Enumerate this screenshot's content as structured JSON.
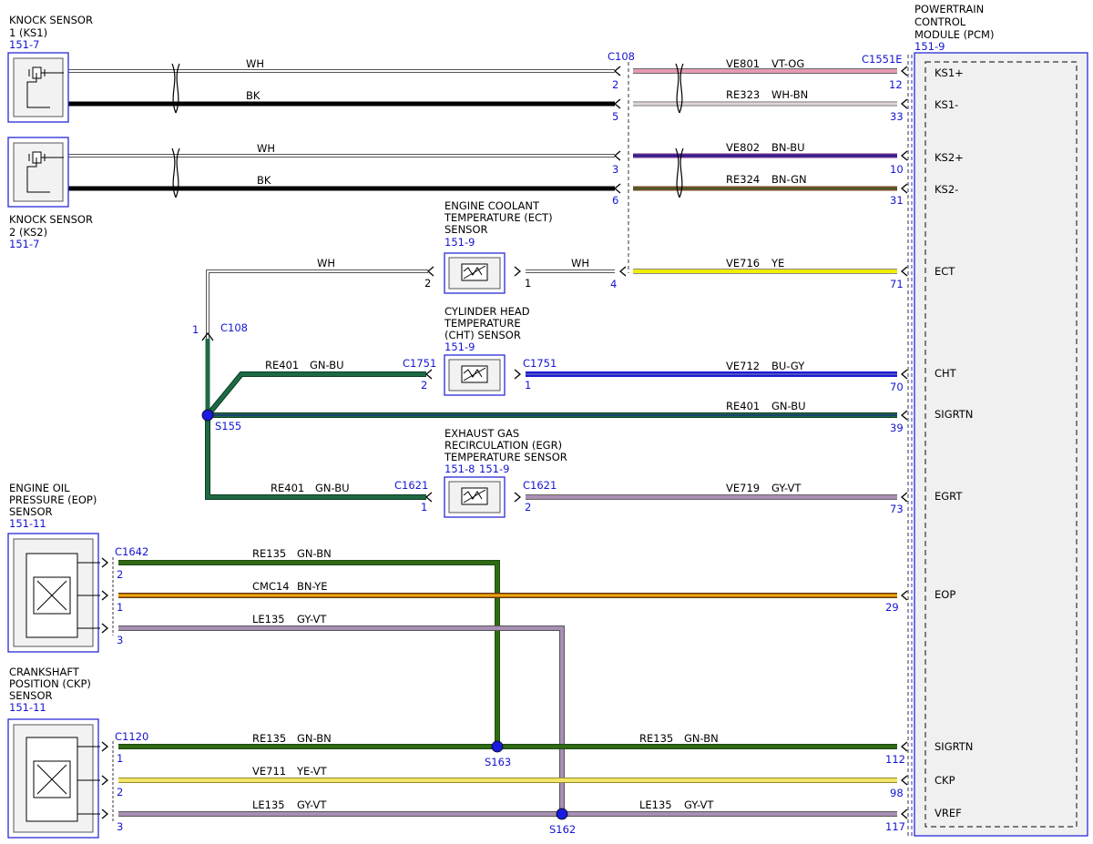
{
  "components": {
    "ks1": {
      "lines": [
        "KNOCK SENSOR",
        "1 (KS1)"
      ],
      "ref": "151-7"
    },
    "ks2": {
      "lines": [
        "KNOCK SENSOR",
        "2 (KS2)"
      ],
      "ref": "151-7"
    },
    "pcm": {
      "lines": [
        "POWERTRAIN",
        "CONTROL",
        "MODULE (PCM)"
      ],
      "ref": "151-9"
    },
    "ect": {
      "lines": [
        "ENGINE COOLANT",
        "TEMPERATURE (ECT)",
        "SENSOR"
      ],
      "ref": "151-9"
    },
    "cht": {
      "lines": [
        "CYLINDER HEAD",
        "TEMPERATURE",
        "(CHT) SENSOR"
      ],
      "ref": "151-9"
    },
    "egr": {
      "lines": [
        "EXHAUST GAS",
        "RECIRCULATION (EGR)",
        "TEMPERATURE SENSOR"
      ],
      "ref": "151-8",
      "ref2": "151-9"
    },
    "eop": {
      "lines": [
        "ENGINE OIL",
        "PRESSURE (EOP)",
        "SENSOR"
      ],
      "ref": "151-11"
    },
    "ckp": {
      "lines": [
        "CRANKSHAFT",
        "POSITION (CKP)",
        "SENSOR"
      ],
      "ref": "151-11"
    }
  },
  "pcm_pins": [
    "KS1+",
    "KS1-",
    "KS2+",
    "KS2-",
    "ECT",
    "CHT",
    "SIGRTN",
    "EGRT",
    "EOP",
    "SIGRTN",
    "CKP",
    "VREF"
  ],
  "connectors": {
    "c108_top": "C108",
    "c1551e": "C1551E",
    "c108_mid": "C108",
    "c1751_left": "C1751",
    "c1751_right": "C1751",
    "c1621_left": "C1621",
    "c1621_right": "C1621",
    "c1642": "C1642",
    "c1120": "C1120"
  },
  "splices": {
    "s155": "S155",
    "s163": "S163",
    "s162": "S162"
  },
  "pins": {
    "c108_2": "2",
    "c108_5": "5",
    "c108_3": "3",
    "c108_6": "6",
    "c108_4": "4",
    "pcm_12": "12",
    "pcm_33": "33",
    "pcm_10": "10",
    "pcm_31": "31",
    "pcm_71": "71",
    "pcm_70": "70",
    "pcm_39": "39",
    "pcm_73": "73",
    "pcm_29": "29",
    "pcm_112": "112",
    "pcm_98": "98",
    "pcm_117": "117",
    "ect_2": "2",
    "ect_1": "1",
    "c108mid_1": "1",
    "cht_2": "2",
    "cht_1": "1",
    "egr_1": "1",
    "egr_2": "2",
    "eop_2": "2",
    "eop_1": "1",
    "eop_3": "3",
    "ckp_1": "1",
    "ckp_2": "2",
    "ckp_3": "3"
  },
  "wires": {
    "ks1_wh": "WH",
    "ks1_bk": "BK",
    "ks2_wh": "WH",
    "ks2_bk": "BK",
    "ve801": "VE801",
    "ve801_c": "VT-OG",
    "re323": "RE323",
    "re323_c": "WH-BN",
    "ve802": "VE802",
    "ve802_c": "BN-BU",
    "re324": "RE324",
    "re324_c": "BN-GN",
    "ect_wh_left": "WH",
    "ect_wh_right": "WH",
    "ve716": "VE716",
    "ve716_c": "YE",
    "re401_cht": "RE401",
    "re401_cht_c": "GN-BU",
    "ve712": "VE712",
    "ve712_c": "BU-GY",
    "re401_pcm": "RE401",
    "re401_pcm_c": "GN-BU",
    "re401_egr": "RE401",
    "re401_egr_c": "GN-BU",
    "ve719": "VE719",
    "ve719_c": "GY-VT",
    "re135_eop": "RE135",
    "re135_eop_c": "GN-BN",
    "cmc14": "CMC14",
    "cmc14_c": "BN-YE",
    "le135_eop": "LE135",
    "le135_eop_c": "GY-VT",
    "re135_ckp": "RE135",
    "re135_ckp_c": "GN-BN",
    "re135_pcm": "RE135",
    "re135_pcm_c": "GN-BN",
    "ve711": "VE711",
    "ve711_c": "YE-VT",
    "le135_ckp": "LE135",
    "le135_ckp_c": "GY-VT",
    "le135_pcm": "LE135",
    "le135_pcm_c": "GY-VT"
  },
  "colors": {
    "label_blue": "#1414d2",
    "vt_og": "#e59ab0",
    "wh_bn": "#c9a6a6",
    "bn_bu": "#6a2c86",
    "bn_gn": "#7a4a26",
    "ye": "#f2ee00",
    "bu_gy": "#1a1ad4",
    "gn_bu": "#1d6a45",
    "gy_vt": "#a98fb4",
    "gn_bn": "#2f6a16",
    "bn_ye": "#c7681a",
    "ye_vt": "#e8d85a"
  }
}
